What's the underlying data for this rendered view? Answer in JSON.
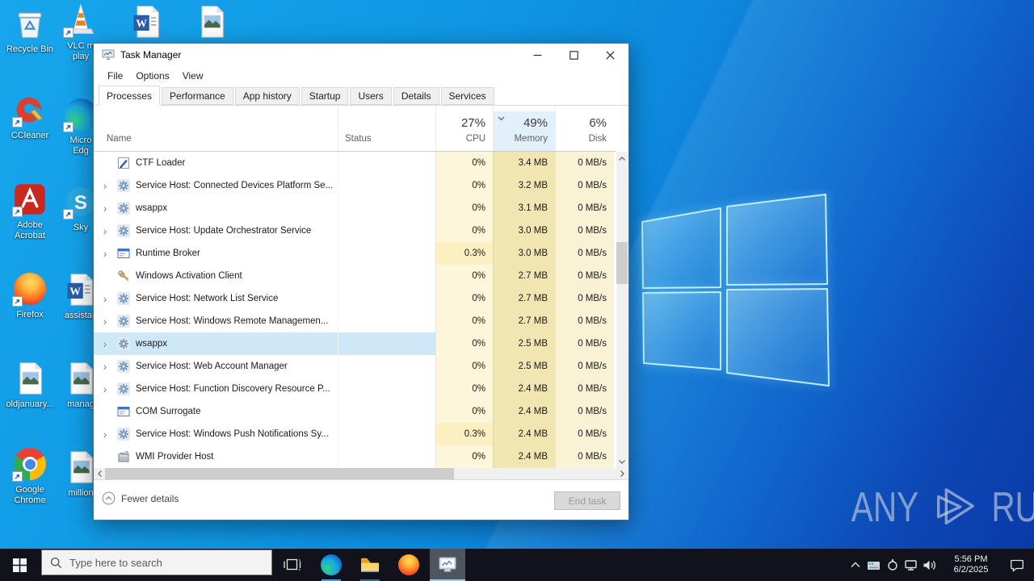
{
  "desktop": {
    "top_row": [
      {
        "icon": "word-doc"
      },
      {
        "icon": "image-file"
      }
    ],
    "column1": [
      {
        "icon": "recycle-bin",
        "label": "Recycle Bin",
        "shortcut": false
      },
      {
        "icon": "ccleaner",
        "label": "CCleaner",
        "shortcut": true
      },
      {
        "icon": "adobe",
        "label": "Adobe\nAcrobat",
        "shortcut": true
      },
      {
        "icon": "firefox",
        "label": "Firefox",
        "shortcut": true
      },
      {
        "icon": "image-file",
        "label": "oldjanuary...",
        "shortcut": false
      },
      {
        "icon": "chrome",
        "label": "Google\nChrome",
        "shortcut": true
      }
    ],
    "column2": [
      {
        "icon": "vlc",
        "label": "VLC m\nplay",
        "shortcut": true
      },
      {
        "icon": "edge",
        "label": "Micro\nEdg",
        "shortcut": true
      },
      {
        "icon": "skype",
        "label": "Sky",
        "shortcut": true
      },
      {
        "icon": "word-doc",
        "label": "assistan",
        "shortcut": false
      },
      {
        "icon": "image-file",
        "label": "manag",
        "shortcut": false
      },
      {
        "icon": "image-file",
        "label": "million",
        "shortcut": false
      }
    ]
  },
  "watermark": {
    "text_left": "ANY",
    "text_right": "RUN"
  },
  "task_manager": {
    "title": "Task Manager",
    "menu": [
      "File",
      "Options",
      "View"
    ],
    "tabs": [
      "Processes",
      "Performance",
      "App history",
      "Startup",
      "Users",
      "Details",
      "Services"
    ],
    "active_tab": "Processes",
    "header": {
      "name": "Name",
      "status": "Status",
      "cpu_pct": "27%",
      "cpu": "CPU",
      "memory_pct": "49%",
      "memory": "Memory",
      "disk_pct": "6%",
      "disk": "Disk"
    },
    "processes": [
      {
        "name": "CTF Loader",
        "icon": "pen-document",
        "expandable": false,
        "status": "",
        "cpu": "0%",
        "memory": "3.4 MB",
        "disk": "0 MB/s"
      },
      {
        "name": "Service Host: Connected Devices Platform Se...",
        "icon": "gear",
        "expandable": true,
        "status": "",
        "cpu": "0%",
        "memory": "3.2 MB",
        "disk": "0 MB/s"
      },
      {
        "name": "wsappx",
        "icon": "gear",
        "expandable": true,
        "status": "",
        "cpu": "0%",
        "memory": "3.1 MB",
        "disk": "0 MB/s"
      },
      {
        "name": "Service Host: Update Orchestrator Service",
        "icon": "gear",
        "expandable": true,
        "status": "",
        "cpu": "0%",
        "memory": "3.0 MB",
        "disk": "0 MB/s"
      },
      {
        "name": "Runtime Broker",
        "icon": "app-window",
        "expandable": true,
        "status": "",
        "cpu": "0.3%",
        "memory": "3.0 MB",
        "disk": "0 MB/s"
      },
      {
        "name": "Windows Activation Client",
        "icon": "keys",
        "expandable": false,
        "status": "",
        "cpu": "0%",
        "memory": "2.7 MB",
        "disk": "0 MB/s"
      },
      {
        "name": "Service Host: Network List Service",
        "icon": "gear",
        "expandable": true,
        "status": "",
        "cpu": "0%",
        "memory": "2.7 MB",
        "disk": "0 MB/s"
      },
      {
        "name": "Service Host: Windows Remote Managemen...",
        "icon": "gear",
        "expandable": true,
        "status": "",
        "cpu": "0%",
        "memory": "2.7 MB",
        "disk": "0 MB/s"
      },
      {
        "name": "wsappx",
        "icon": "gear",
        "expandable": true,
        "selected": true,
        "status": "",
        "cpu": "0%",
        "memory": "2.5 MB",
        "disk": "0 MB/s"
      },
      {
        "name": "Service Host: Web Account Manager",
        "icon": "gear",
        "expandable": true,
        "status": "",
        "cpu": "0%",
        "memory": "2.5 MB",
        "disk": "0 MB/s"
      },
      {
        "name": "Service Host: Function Discovery Resource P...",
        "icon": "gear",
        "expandable": true,
        "status": "",
        "cpu": "0%",
        "memory": "2.4 MB",
        "disk": "0 MB/s"
      },
      {
        "name": "COM Surrogate",
        "icon": "app-window",
        "expandable": false,
        "status": "",
        "cpu": "0%",
        "memory": "2.4 MB",
        "disk": "0 MB/s"
      },
      {
        "name": "Service Host: Windows Push Notifications Sy...",
        "icon": "gear",
        "expandable": true,
        "status": "",
        "cpu": "0.3%",
        "memory": "2.4 MB",
        "disk": "0 MB/s"
      },
      {
        "name": "WMI Provider Host",
        "icon": "wmi",
        "expandable": false,
        "status": "",
        "cpu": "0%",
        "memory": "2.4 MB",
        "disk": "0 MB/s"
      }
    ],
    "footer": {
      "fewer_details": "Fewer details",
      "end_task": "End task"
    }
  },
  "taskbar": {
    "search_placeholder": "Type here to search",
    "clock": {
      "time": "5:56 PM",
      "date": "6/2/2025"
    }
  }
}
